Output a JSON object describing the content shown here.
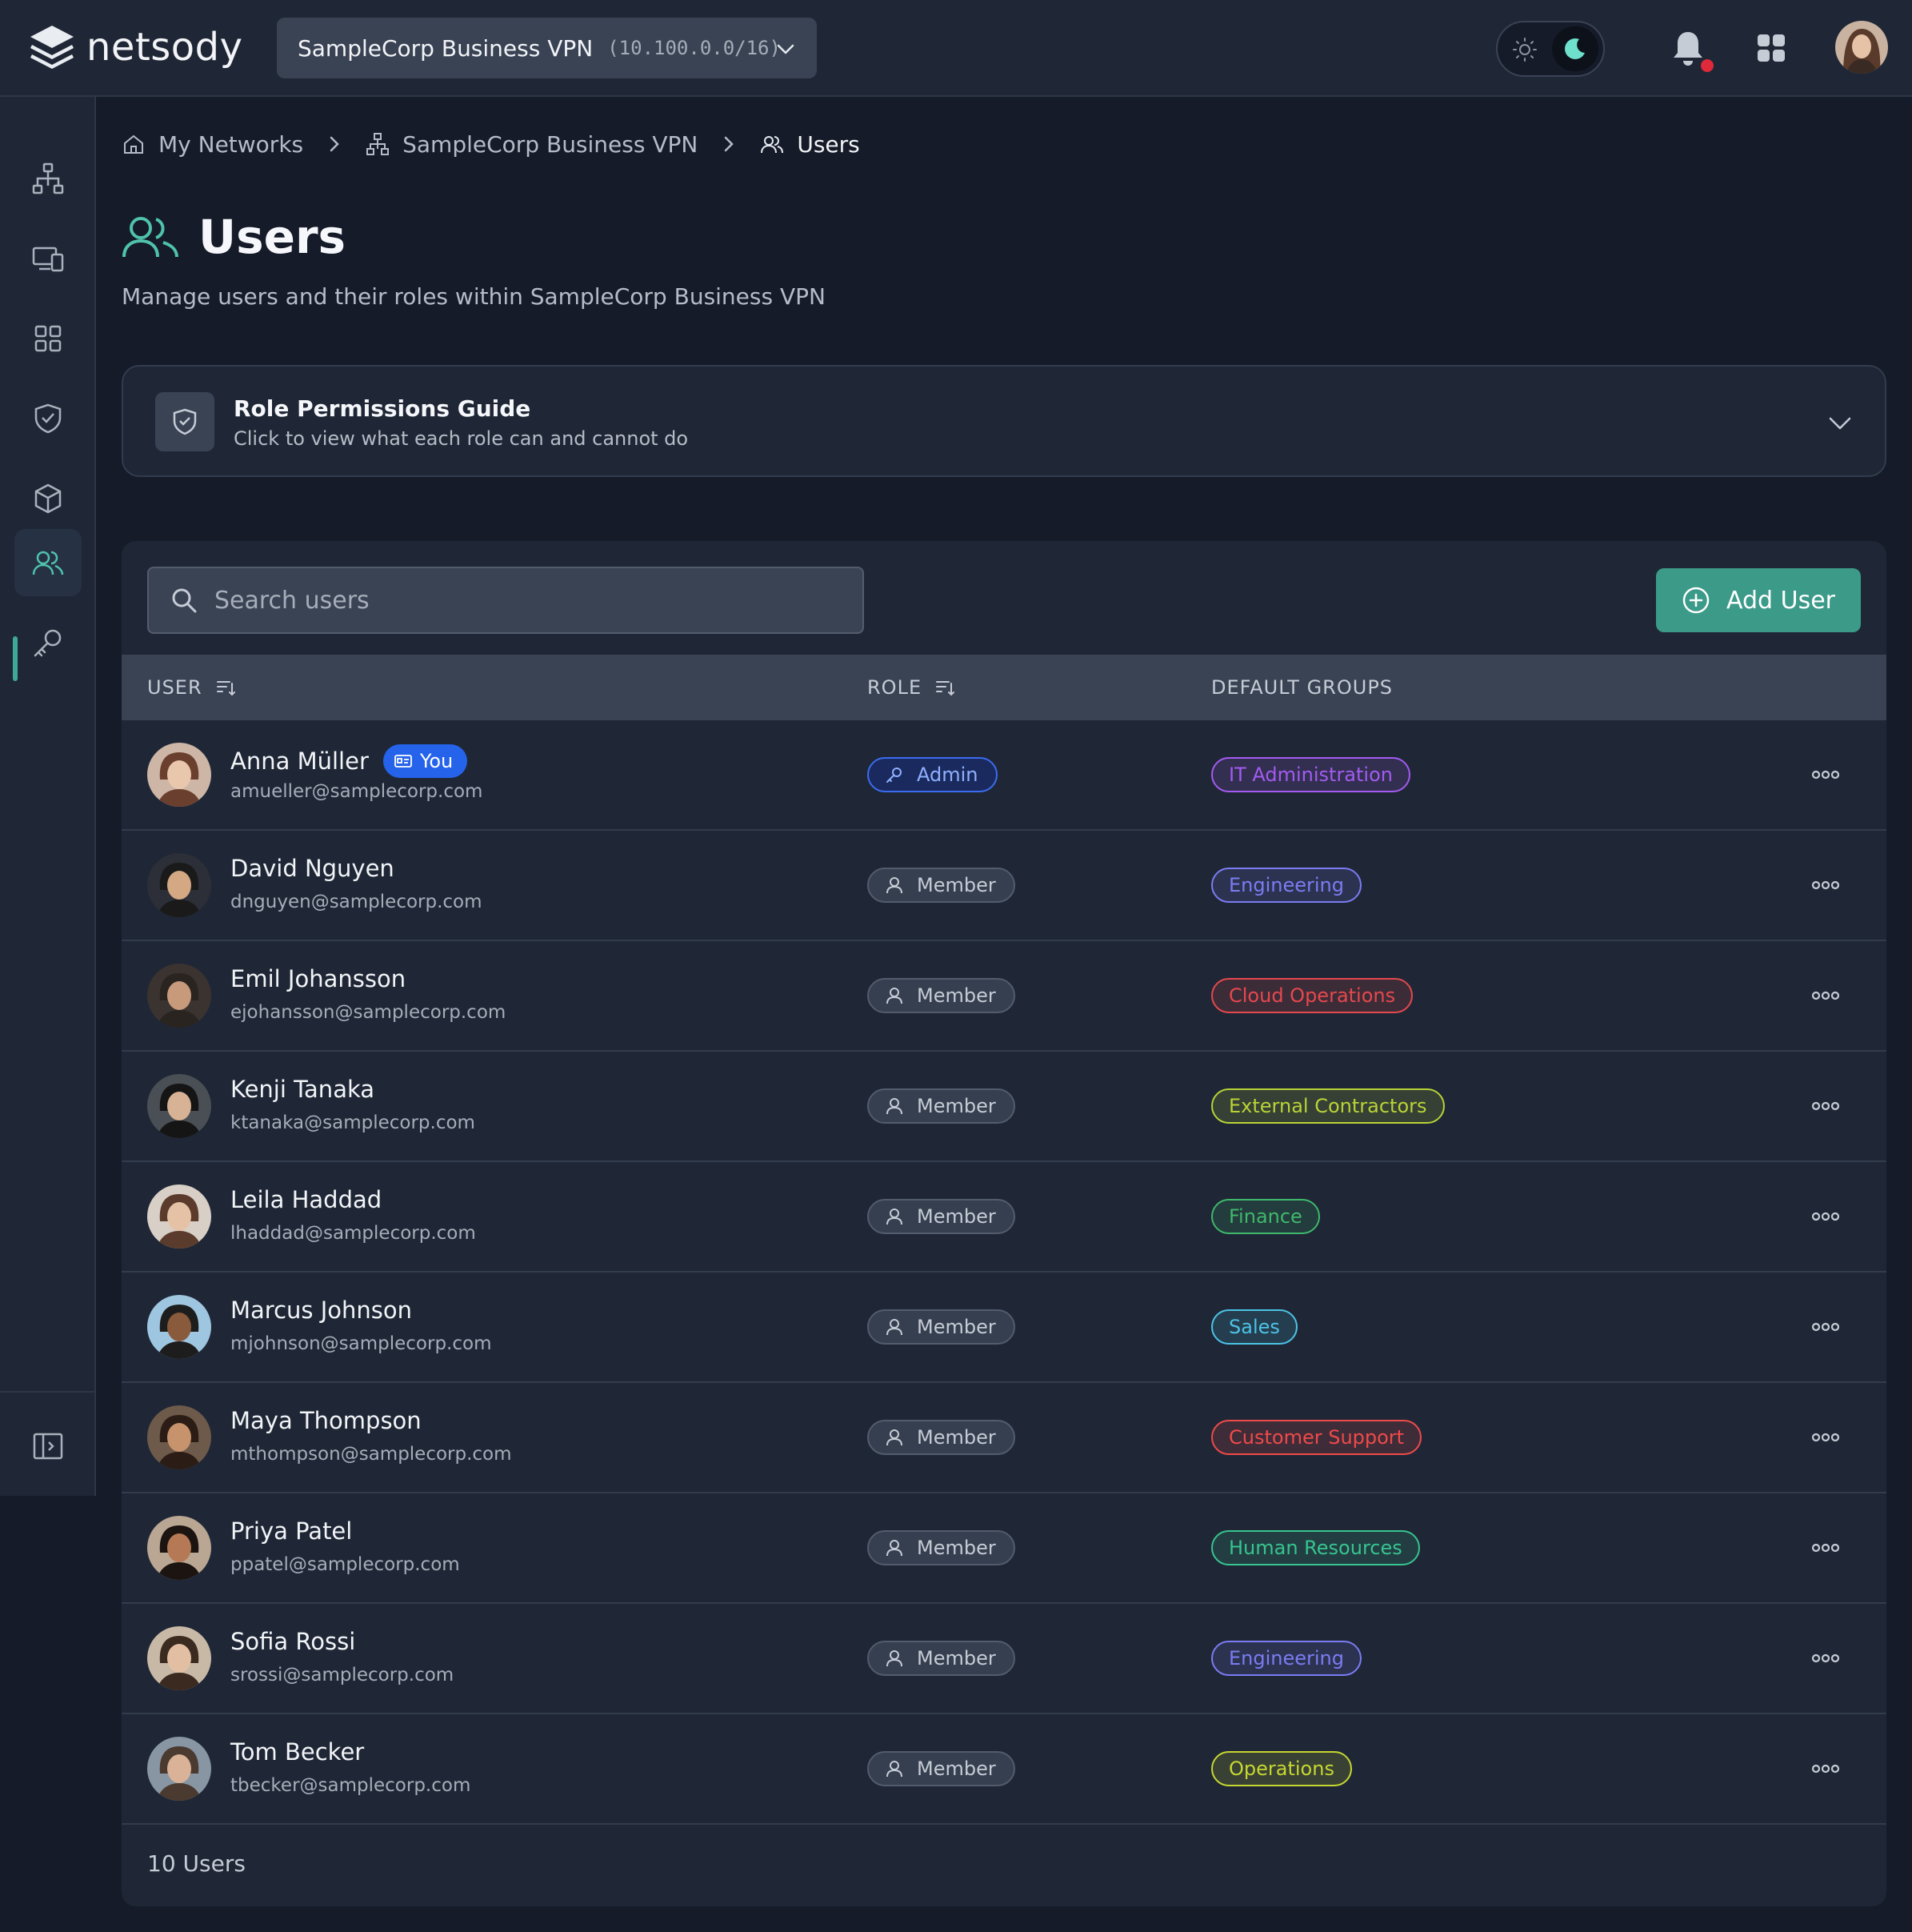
{
  "app": {
    "brand": "netsody"
  },
  "topbar": {
    "network_name": "SampleCorp Business VPN",
    "network_cidr": "(10.100.0.0/16)",
    "icons": [
      "sun-icon",
      "moon-icon",
      "bell-icon",
      "apps-grid-icon"
    ]
  },
  "breadcrumb": {
    "items": [
      "My Networks",
      "SampleCorp Business VPN",
      "Users"
    ]
  },
  "page": {
    "title": "Users",
    "subtitle": "Manage users and their roles within SampleCorp Business VPN"
  },
  "permissions_guide": {
    "title": "Role Permissions Guide",
    "description": "Click to view what each role can and cannot do"
  },
  "toolbar": {
    "search_placeholder": "Search users",
    "add_user_label": "Add User"
  },
  "table": {
    "columns": [
      "USER",
      "ROLE",
      "DEFAULT GROUPS"
    ],
    "you_label": "You",
    "rows": [
      {
        "name": "Anna Müller",
        "email": "amueller@samplecorp.com",
        "role": "Admin",
        "group": "IT Administration",
        "group_color": "#a35bf0",
        "is_you": true
      },
      {
        "name": "David Nguyen",
        "email": "dnguyen@samplecorp.com",
        "role": "Member",
        "group": "Engineering",
        "group_color": "#7b7cf2"
      },
      {
        "name": "Emil Johansson",
        "email": "ejohansson@samplecorp.com",
        "role": "Member",
        "group": "Cloud Operations",
        "group_color": "#e5484d"
      },
      {
        "name": "Kenji Tanaka",
        "email": "ktanaka@samplecorp.com",
        "role": "Member",
        "group": "External Contractors",
        "group_color": "#b9d336"
      },
      {
        "name": "Leila Haddad",
        "email": "lhaddad@samplecorp.com",
        "role": "Member",
        "group": "Finance",
        "group_color": "#3fb86b"
      },
      {
        "name": "Marcus Johnson",
        "email": "mjohnson@samplecorp.com",
        "role": "Member",
        "group": "Sales",
        "group_color": "#4cc3e6"
      },
      {
        "name": "Maya Thompson",
        "email": "mthompson@samplecorp.com",
        "role": "Member",
        "group": "Customer Support",
        "group_color": "#ef4a4a"
      },
      {
        "name": "Priya Patel",
        "email": "ppatel@samplecorp.com",
        "role": "Member",
        "group": "Human Resources",
        "group_color": "#37c48f"
      },
      {
        "name": "Sofia Rossi",
        "email": "srossi@samplecorp.com",
        "role": "Member",
        "group": "Engineering",
        "group_color": "#7b7cf2"
      },
      {
        "name": "Tom Becker",
        "email": "tbecker@samplecorp.com",
        "role": "Member",
        "group": "Operations",
        "group_color": "#c7d730"
      }
    ],
    "footer": "10 Users"
  },
  "colors": {
    "accent": "#3c9a89",
    "background": "#151b28",
    "surface": "#1f2736",
    "notification_dot": "#e0293a",
    "you_badge": "#2563eb"
  }
}
